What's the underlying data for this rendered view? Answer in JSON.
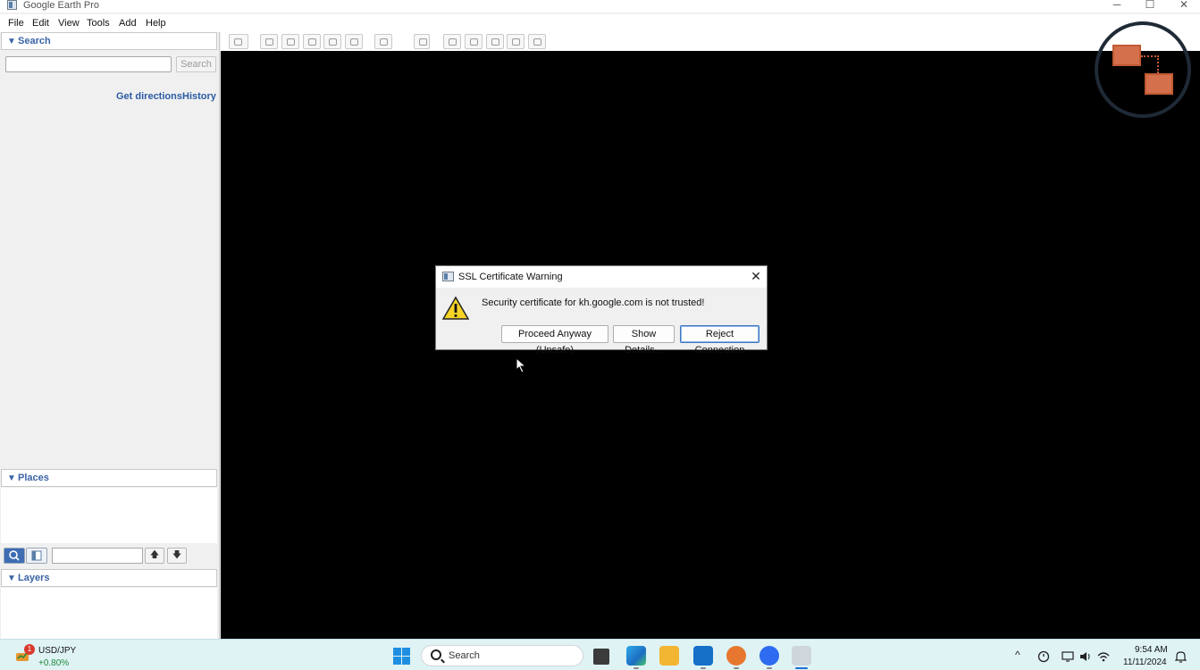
{
  "window": {
    "title": "Google Earth Pro",
    "controls": {
      "minimize": "─",
      "maximize": "☐",
      "close": "✕"
    }
  },
  "menubar": {
    "items": [
      "File",
      "Edit",
      "View",
      "Tools",
      "Add",
      "Help"
    ]
  },
  "sidebar": {
    "search": {
      "header": "Search",
      "input_value": "",
      "button_label": "Search",
      "links": [
        "Get directions",
        "History"
      ]
    },
    "places": {
      "header": "Places",
      "filter_value": "",
      "up_label": "🡅",
      "down_label": "🡇"
    },
    "layers": {
      "header": "Layers"
    }
  },
  "dialog": {
    "title": "SSL Certificate Warning",
    "close_glyph": "✕",
    "message": "Security certificate for kh.google.com is not trusted!",
    "buttons": {
      "proceed": "Proceed Anyway (Unsafe)",
      "details": "Show Details...",
      "reject": "Reject Connection"
    }
  },
  "taskbar": {
    "widget": {
      "badge": "1",
      "pair": "USD/JPY",
      "change": "+0.80%"
    },
    "search_label": "Search",
    "tray": {
      "chevron": "^"
    },
    "clock": {
      "time": "9:54 AM",
      "date": "11/11/2024"
    },
    "apps": [
      "file-explorer",
      "edge",
      "folder",
      "outlook",
      "mozilla",
      "zoom",
      "google-earth"
    ]
  },
  "colors": {
    "accent_blue": "#3a63a5",
    "link_blue": "#2b5aa3",
    "map_background": "#000000",
    "taskbar": "#dff3f5",
    "logo_orange": "#d4704b"
  }
}
